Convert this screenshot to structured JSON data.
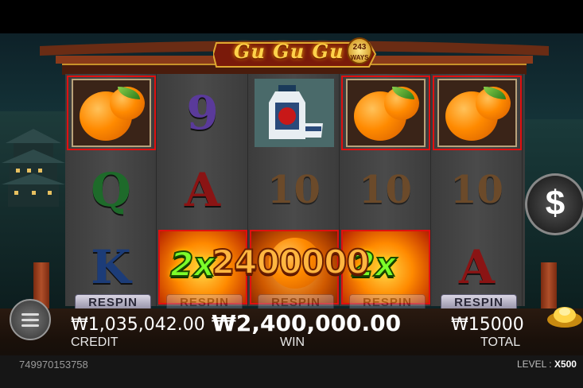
{
  "game": {
    "title": "Gu Gu Gu 3",
    "ways_number": "243",
    "ways_label": "WAYS"
  },
  "reels": [
    [
      "orange",
      "Q",
      "K"
    ],
    [
      "9",
      "A",
      "gold"
    ],
    [
      "wine-jar",
      "10",
      "orange"
    ],
    [
      "orange",
      "10",
      "gold"
    ],
    [
      "orange",
      "10",
      "A"
    ]
  ],
  "multipliers": [
    "2x",
    "2x"
  ],
  "big_win_display": "2400000",
  "respin_buttons": [
    "RESPIN",
    "RESPIN",
    "RESPIN",
    "RESPIN",
    "RESPIN"
  ],
  "credit": {
    "value": "₩1,035,042.00",
    "label": "CREDIT"
  },
  "win": {
    "value": "₩2,400,000.00",
    "label": "WIN"
  },
  "total": {
    "value": "₩15000",
    "label": "TOTAL"
  },
  "spin_symbol": "$",
  "footer": {
    "round_id": "749970153758",
    "level_label": "LEVEL :",
    "level_value": "X500"
  },
  "colors": {
    "win_border": "#e01010",
    "multiplier": "#7cff2a",
    "big_win": "#ffb640",
    "q_green": "#1e6a2a",
    "k_blue": "#1c3c78",
    "a_red": "#8a1414",
    "nine_purple": "#5a3a9a"
  },
  "icons": [
    "menu-icon",
    "dollar-spin-icon",
    "gold-ingot-icon"
  ]
}
